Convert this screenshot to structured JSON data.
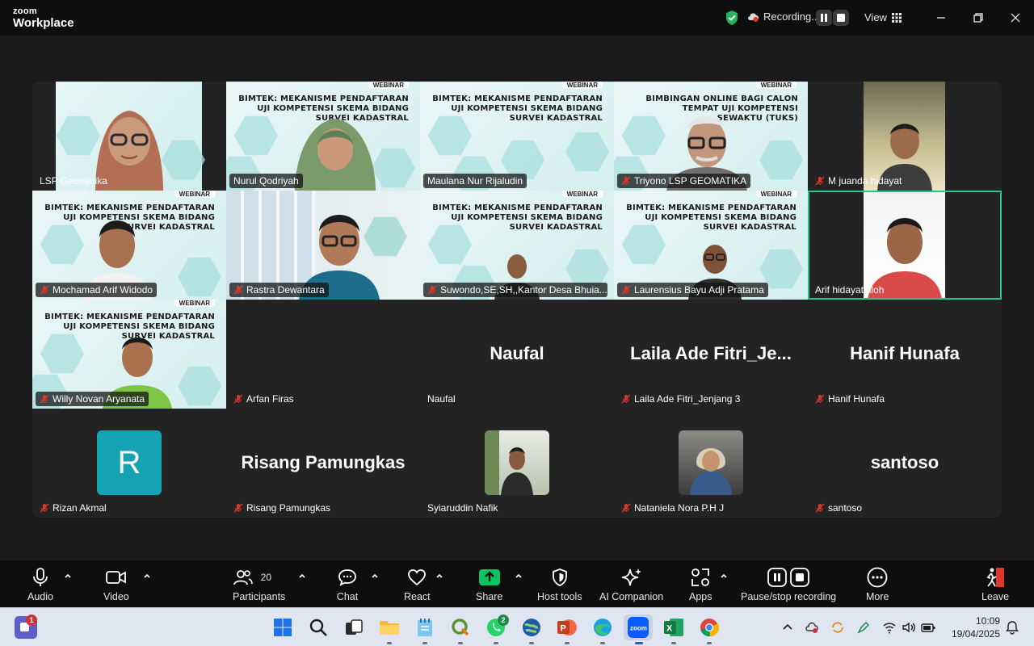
{
  "app": {
    "brand_top": "zoom",
    "brand_bottom": "Workplace"
  },
  "titlebar": {
    "recording_label": "Recording...",
    "view_label": "View"
  },
  "tiles": [
    {
      "name": "LSP Geomatika",
      "muted": false
    },
    {
      "name": "Nurul Qodriyah",
      "muted": false
    },
    {
      "name": "Maulana Nur Rijaludin",
      "muted": false
    },
    {
      "name": "Triyono LSP GEOMATIKA",
      "muted": true
    },
    {
      "name": "M juanda hidayat",
      "muted": true
    },
    {
      "name": "Mochamad Arif Widodo",
      "muted": true
    },
    {
      "name": "Rastra Dewantara",
      "muted": true
    },
    {
      "name": "Suwondo,SE,SH,,Kantor Desa Bhuia...",
      "muted": true
    },
    {
      "name": "Laurensius Bayu Adji Pratama",
      "muted": true
    },
    {
      "name": "Arif hidayatulloh",
      "muted": false
    },
    {
      "name": "Willy Novan Aryanata",
      "muted": true
    },
    {
      "name": "Arfan Firas",
      "muted": true
    },
    {
      "name": "Naufal",
      "muted": false,
      "display": "Naufal"
    },
    {
      "name": "Laila Ade Fitri_Jenjang 3",
      "muted": true,
      "display": "Laila  Ade  Fitri_Je..."
    },
    {
      "name": "Hanif Hunafa",
      "muted": true,
      "display": "Hanif  Hunafa"
    },
    {
      "name": "Rizan Akmal",
      "muted": true,
      "avatar_letter": "R"
    },
    {
      "name": "Risang Pamungkas",
      "muted": true,
      "display": "Risang  Pamungkas"
    },
    {
      "name": "Syiaruddin Nafik",
      "muted": false
    },
    {
      "name": "Nataniela Nora P.H J",
      "muted": true
    },
    {
      "name": "santoso",
      "muted": true,
      "display": "santoso"
    }
  ],
  "slides": {
    "webinar": "WEBINAR",
    "bimtek": [
      "BIMTEK: MEKANISME PENDAFTARAN",
      "UJI KOMPETENSI SKEMA BIDANG",
      "SURVEI KADASTRAL"
    ],
    "bimbingan": [
      "BIMBINGAN ONLINE BAGI CALON",
      "TEMPAT UJI KOMPETENSI",
      "SEWAKTU (TUKS)"
    ]
  },
  "toolbar": {
    "audio": "Audio",
    "video": "Video",
    "participants": "Participants",
    "participants_count": "20",
    "chat": "Chat",
    "react": "React",
    "share": "Share",
    "host_tools": "Host tools",
    "ai_companion": "AI Companion",
    "apps": "Apps",
    "pause_stop_recording": "Pause/stop recording",
    "more": "More",
    "leave": "Leave"
  },
  "taskbar": {
    "teams_badge": "1",
    "whatsapp_badge": "2",
    "time": "10:09",
    "date": "19/04/2025"
  },
  "colors": {
    "accent_green": "#22c98b",
    "leave_red": "#e0352b",
    "share_green": "#0ec461"
  }
}
